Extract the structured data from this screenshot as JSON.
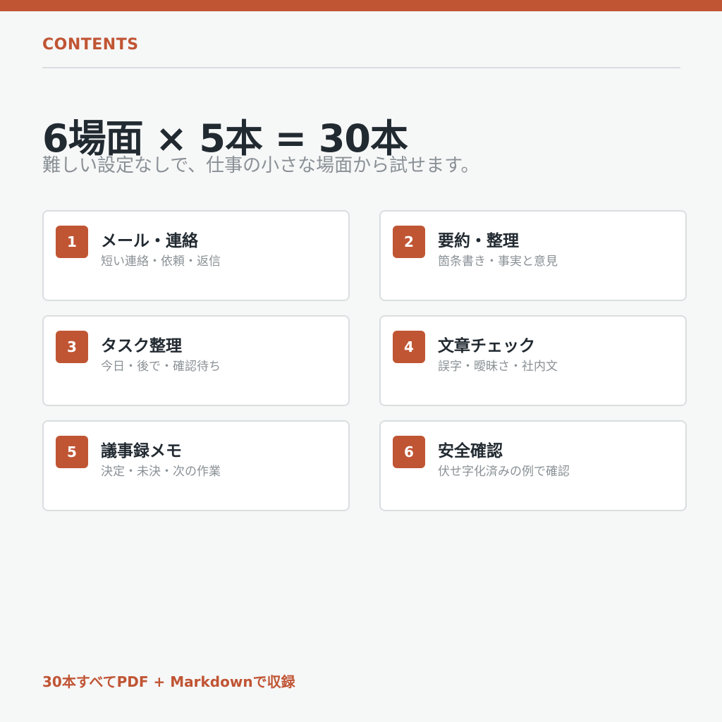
{
  "colors": {
    "accent": "#c05534",
    "background": "#f6f7f7",
    "card_background": "#ffffff",
    "card_border": "#dadee0",
    "heading_text": "#222a31",
    "muted_text": "#8a9196"
  },
  "header": {
    "section_label": "CONTENTS"
  },
  "hero": {
    "headline": "6場面 × 5本 = 30本",
    "subheadline": "難しい設定なしで、仕事の小さな場面から試せます。"
  },
  "cards": [
    {
      "number": "1",
      "title": "メール・連絡",
      "description": "短い連絡・依頼・返信"
    },
    {
      "number": "2",
      "title": "要約・整理",
      "description": "箇条書き・事実と意見"
    },
    {
      "number": "3",
      "title": "タスク整理",
      "description": "今日・後で・確認待ち"
    },
    {
      "number": "4",
      "title": "文章チェック",
      "description": "誤字・曖昧さ・社内文"
    },
    {
      "number": "5",
      "title": "議事録メモ",
      "description": "決定・未決・次の作業"
    },
    {
      "number": "6",
      "title": "安全確認",
      "description": "伏せ字化済みの例で確認"
    }
  ],
  "footer": {
    "note": "30本すべてPDF + Markdownで収録"
  }
}
